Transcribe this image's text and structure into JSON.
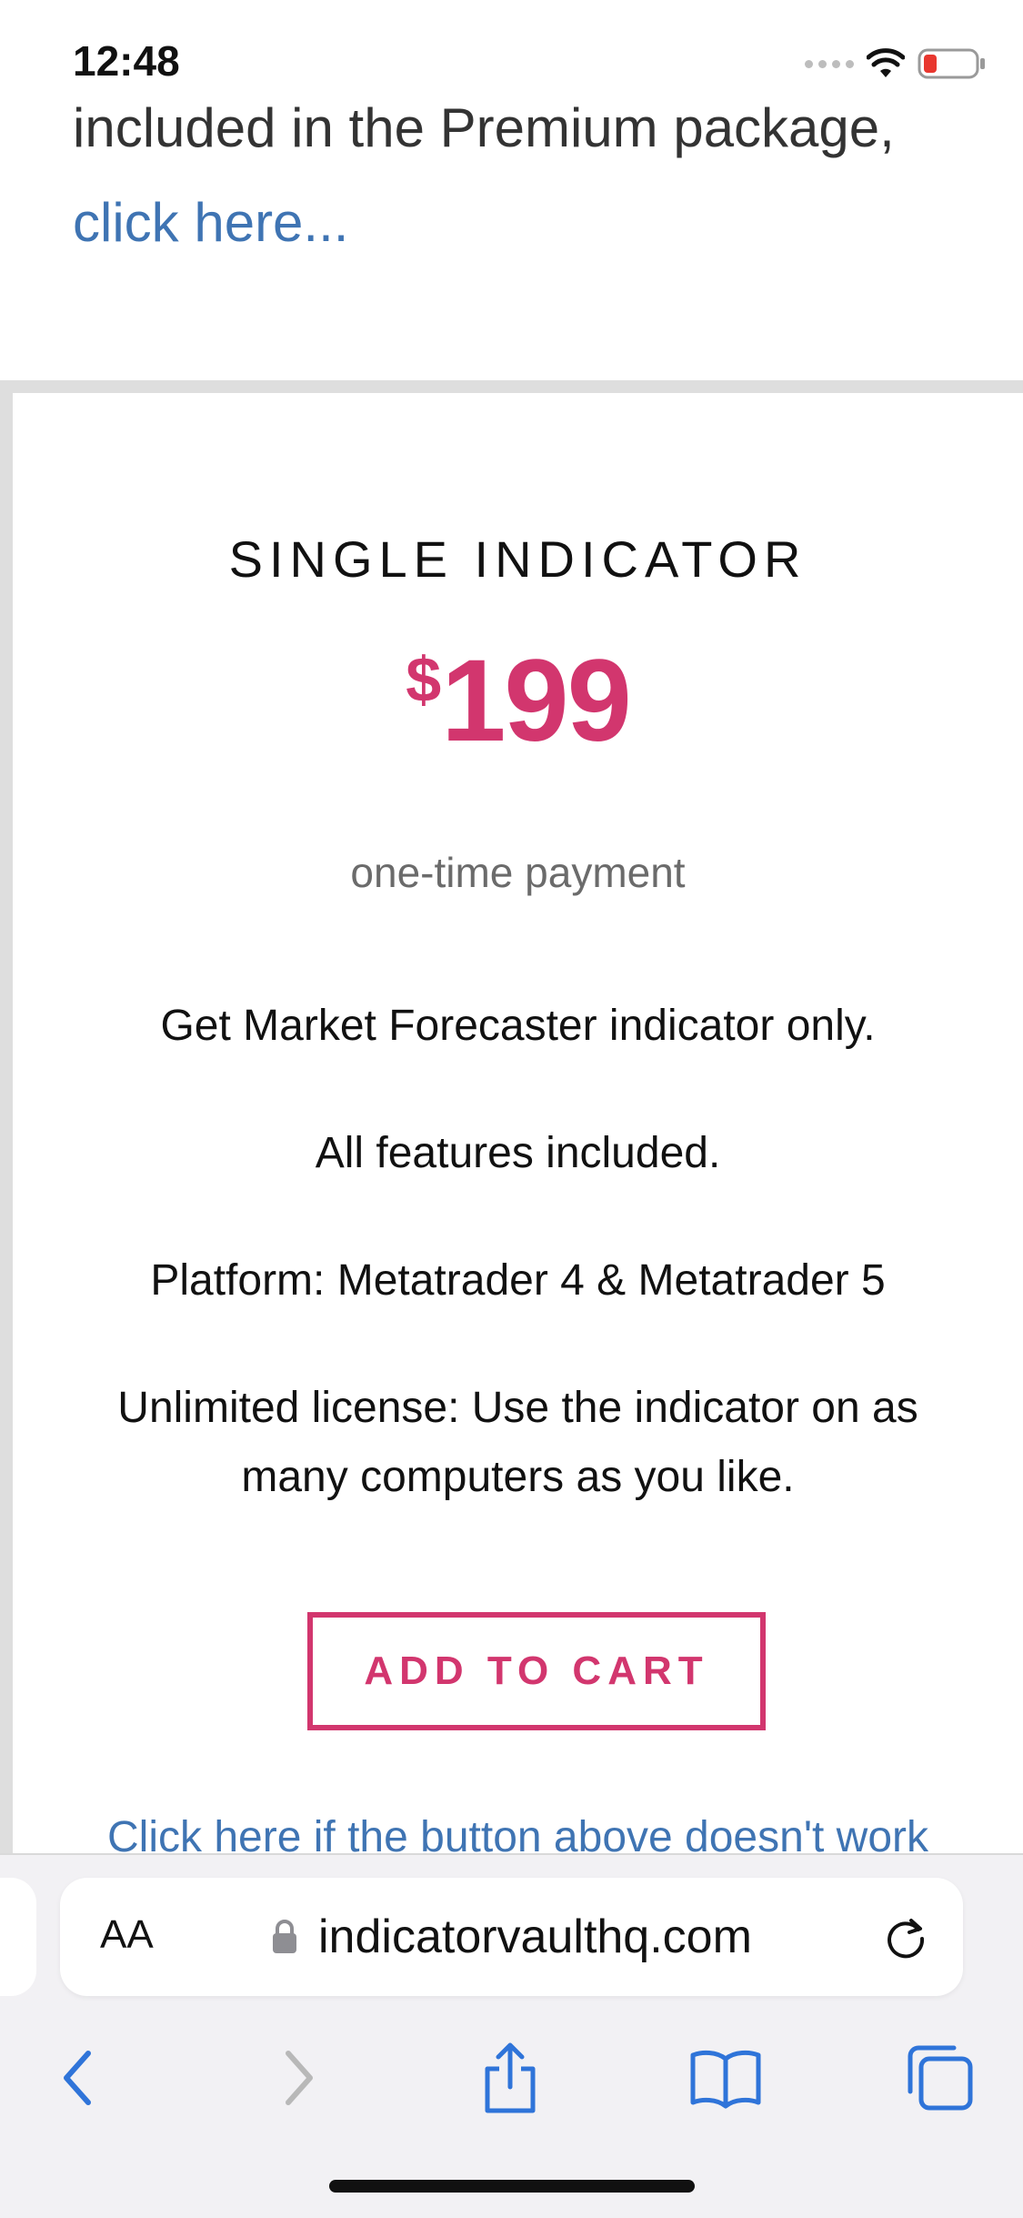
{
  "status_bar": {
    "time": "12:48"
  },
  "top": {
    "partial_text": "included in the Premium package,",
    "link": "click here..."
  },
  "plan": {
    "title": "SINGLE INDICATOR",
    "currency": "$",
    "amount": "199",
    "payment_note": "one-time payment",
    "features": [
      "Get Market Forecaster indicator only.",
      "All features included.",
      "Platform: Metatrader 4 & Metatrader 5",
      "Unlimited license: Use the indicator on as many computers as you like."
    ],
    "cta": "ADD TO CART",
    "fallback_link": "Click here if the button above doesn't work"
  },
  "browser": {
    "text_size_label": "AA",
    "url": "indicatorvaulthq.com"
  },
  "colors": {
    "accent": "#d2366e",
    "link": "#3f74b3",
    "ios_blue": "#2f74d9",
    "disabled": "#b8b8b8"
  }
}
